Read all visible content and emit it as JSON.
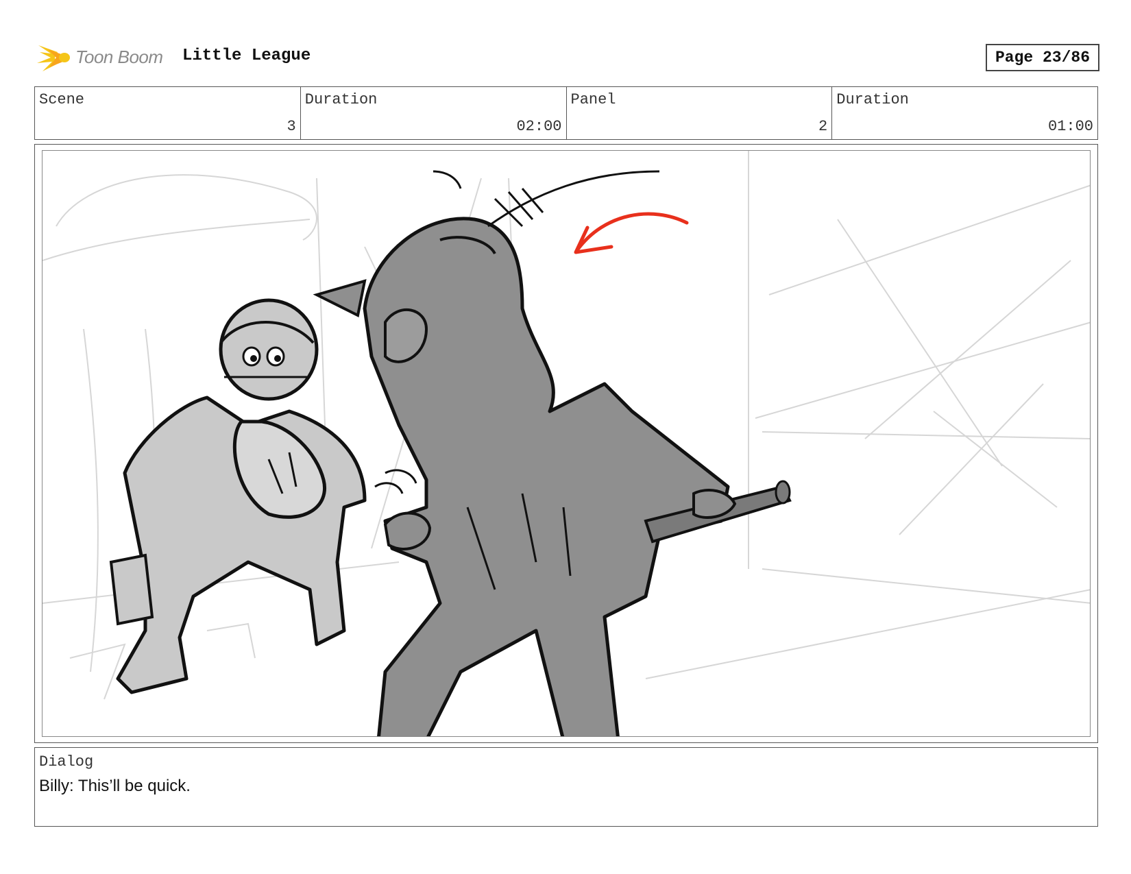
{
  "header": {
    "logo_text": "Toon Boom",
    "project_title": "Little League",
    "page_label": "Page 23/86"
  },
  "info": {
    "scene_label": "Scene",
    "scene_value": "3",
    "scene_duration_label": "Duration",
    "scene_duration_value": "02:00",
    "panel_label": "Panel",
    "panel_value": "2",
    "panel_duration_label": "Duration",
    "panel_duration_value": "01:00"
  },
  "dialog": {
    "label": "Dialog",
    "text": "Billy: This’ll be quick."
  },
  "colors": {
    "logo_accent": "#f5c518",
    "arrow": "#e8301c"
  }
}
